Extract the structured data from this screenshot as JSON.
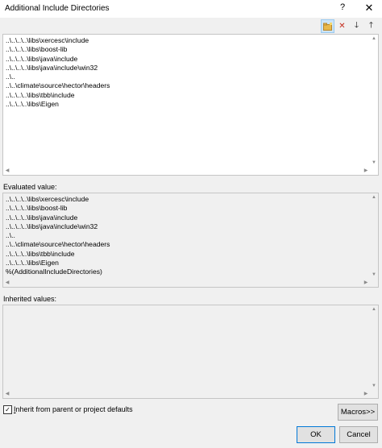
{
  "window": {
    "title": "Additional Include Directories",
    "help_glyph": "?",
    "close_glyph": "✕"
  },
  "toolbar": {
    "new_line_icon": "folder-icon",
    "delete_icon": "delete-icon",
    "move_down_icon": "arrow-down-icon",
    "move_up_icon": "arrow-up-icon"
  },
  "directories": [
    "..\\..\\..\\..\\libs\\xercesc\\include",
    "..\\..\\..\\..\\libs\\boost-lib",
    "..\\..\\..\\..\\libs\\java\\include",
    "..\\..\\..\\..\\libs\\java\\include\\win32",
    "..\\..",
    "..\\..\\climate\\source\\hector\\headers",
    "..\\..\\..\\..\\libs\\tbb\\include",
    "..\\..\\..\\..\\libs\\Eigen"
  ],
  "evaluated_label": "Evaluated value:",
  "evaluated": [
    "..\\..\\..\\..\\libs\\xercesc\\include",
    "..\\..\\..\\..\\libs\\boost-lib",
    "..\\..\\..\\..\\libs\\java\\include",
    "..\\..\\..\\..\\libs\\java\\include\\win32",
    "..\\..",
    "..\\..\\climate\\source\\hector\\headers",
    "..\\..\\..\\..\\libs\\tbb\\include",
    "..\\..\\..\\..\\libs\\Eigen",
    "%(AdditionalIncludeDirectories)"
  ],
  "inherited_label": "Inherited values:",
  "inherit_checkbox": {
    "checked": true,
    "label_prefix": "",
    "label_underline": "I",
    "label_rest": "nherit from parent or project defaults"
  },
  "buttons": {
    "macros": "Macros>>",
    "ok": "OK",
    "cancel": "Cancel"
  }
}
